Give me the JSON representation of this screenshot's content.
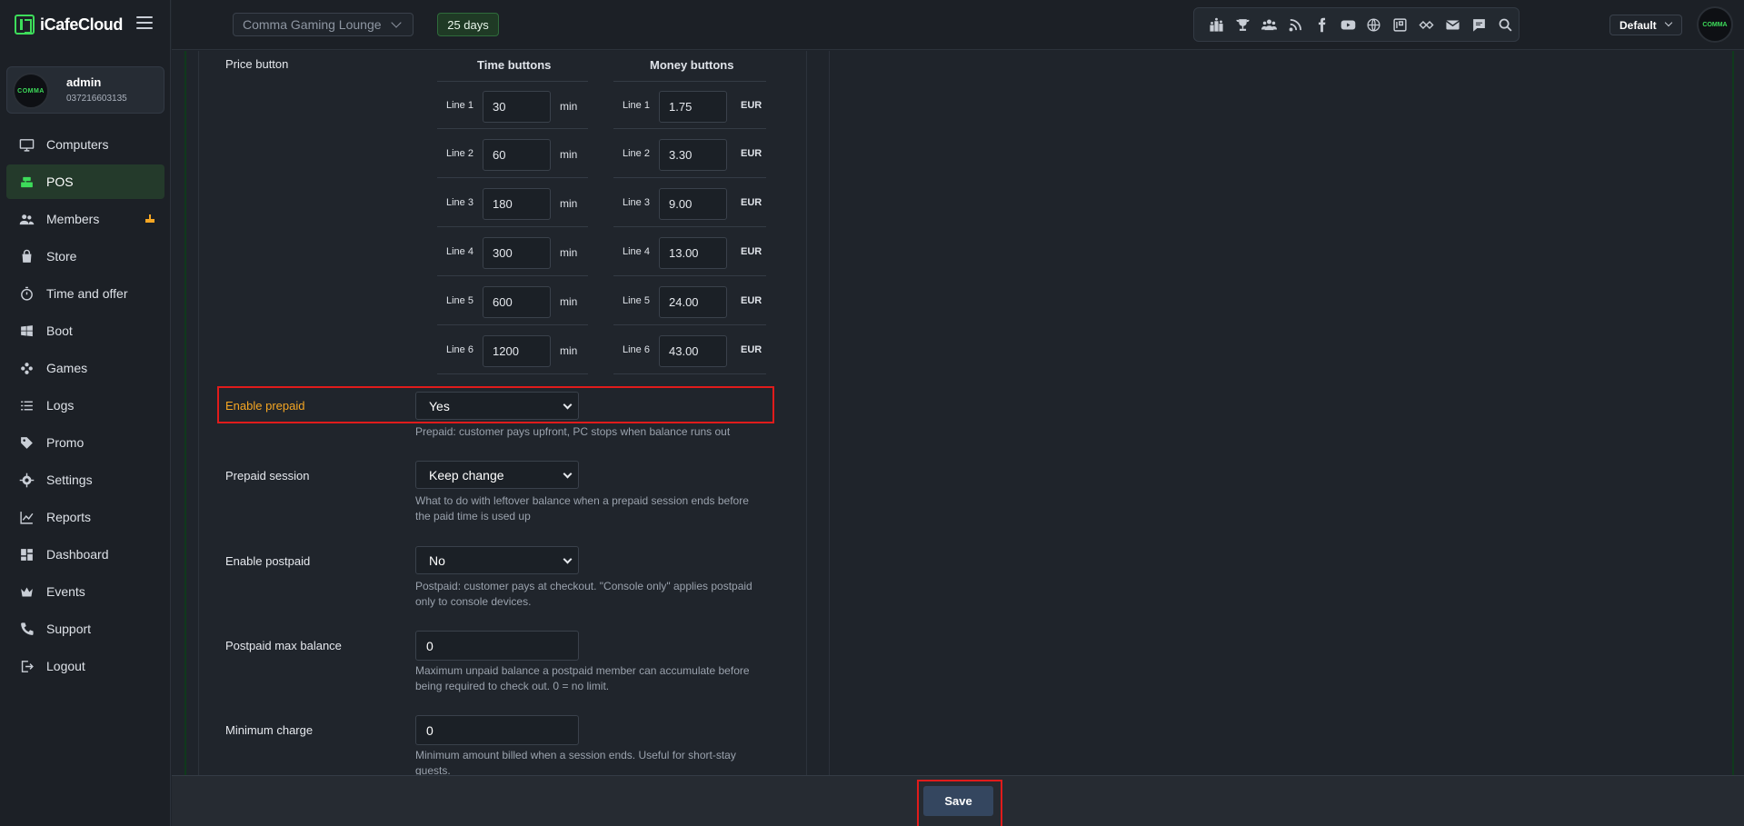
{
  "app": {
    "name": "iCafeCloud",
    "accent": "#3ddc5a",
    "highlight_color": "#e01b1b",
    "warning_color": "#f5a623"
  },
  "user": {
    "name": "admin",
    "phone": "037216603135",
    "avatar_text": "COMMA"
  },
  "sidebar": {
    "items": [
      {
        "label": "Computers",
        "icon": "monitor-icon",
        "active": false
      },
      {
        "label": "POS",
        "icon": "cash-register-icon",
        "active": true
      },
      {
        "label": "Members",
        "icon": "users-icon",
        "active": false,
        "badge_icon": "birthday-cake-icon"
      },
      {
        "label": "Store",
        "icon": "shopping-bag-icon",
        "active": false
      },
      {
        "label": "Time and offer",
        "icon": "stopwatch-icon",
        "active": false
      },
      {
        "label": "Boot",
        "icon": "windows-icon",
        "active": false
      },
      {
        "label": "Games",
        "icon": "gamepad-icon",
        "active": false
      },
      {
        "label": "Logs",
        "icon": "list-icon",
        "active": false
      },
      {
        "label": "Promo",
        "icon": "tag-icon",
        "active": false
      },
      {
        "label": "Settings",
        "icon": "gear-icon",
        "active": false
      },
      {
        "label": "Reports",
        "icon": "chart-line-icon",
        "active": false
      },
      {
        "label": "Dashboard",
        "icon": "dashboard-icon",
        "active": false
      },
      {
        "label": "Events",
        "icon": "crown-icon",
        "active": false
      },
      {
        "label": "Support",
        "icon": "phone-icon",
        "active": false
      },
      {
        "label": "Logout",
        "icon": "logout-icon",
        "active": false
      }
    ]
  },
  "topbar": {
    "lounge": "Comma Gaming Lounge",
    "days_left": "25 days",
    "profile": "Default",
    "icons": [
      "leaderboard-icon",
      "trophy-icon",
      "group-icon",
      "rss-icon",
      "facebook-icon",
      "youtube-icon",
      "globe-icon",
      "icafe-icon",
      "handshake-icon",
      "mail-icon",
      "chat-icon",
      "search-icon"
    ]
  },
  "form": {
    "price_button": {
      "label": "Price button",
      "time_header": "Time buttons",
      "money_header": "Money buttons",
      "time_unit": "min",
      "money_unit": "EUR",
      "time_lines": [
        {
          "label": "Line 1",
          "value": "30"
        },
        {
          "label": "Line 2",
          "value": "60"
        },
        {
          "label": "Line 3",
          "value": "180"
        },
        {
          "label": "Line 4",
          "value": "300"
        },
        {
          "label": "Line 5",
          "value": "600"
        },
        {
          "label": "Line 6",
          "value": "1200"
        }
      ],
      "money_lines": [
        {
          "label": "Line 1",
          "value": "1.75"
        },
        {
          "label": "Line 2",
          "value": "3.30"
        },
        {
          "label": "Line 3",
          "value": "9.00"
        },
        {
          "label": "Line 4",
          "value": "13.00"
        },
        {
          "label": "Line 5",
          "value": "24.00"
        },
        {
          "label": "Line 6",
          "value": "43.00"
        }
      ]
    },
    "enable_prepaid": {
      "label": "Enable prepaid",
      "value": "Yes",
      "help": "Prepaid: customer pays upfront, PC stops when balance runs out"
    },
    "prepaid_session": {
      "label": "Prepaid session",
      "value": "Keep change",
      "help": "What to do with leftover balance when a prepaid session ends before the paid time is used up"
    },
    "enable_postpaid": {
      "label": "Enable postpaid",
      "value": "No",
      "help": "Postpaid: customer pays at checkout. \"Console only\" applies postpaid only to console devices."
    },
    "postpaid_max_balance": {
      "label": "Postpaid max balance",
      "value": "0",
      "help": "Maximum unpaid balance a postpaid member can accumulate before being required to check out. 0 = no limit."
    },
    "minimum_charge": {
      "label": "Minimum charge",
      "value": "0",
      "help": "Minimum amount billed when a session ends. Useful for short-stay guests."
    }
  },
  "footer": {
    "save_label": "Save"
  }
}
